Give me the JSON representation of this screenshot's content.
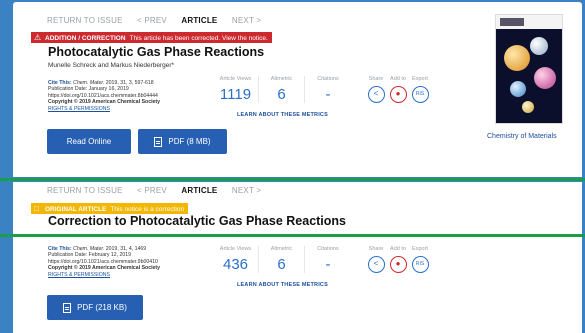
{
  "nav": {
    "return_to_issue": "RETURN TO ISSUE",
    "prev": "< PREV",
    "article": "ARTICLE",
    "next": "NEXT >"
  },
  "top": {
    "badge_strong": "ADDITION / CORRECTION",
    "badge_msg": "This article has been corrected. View the notice.",
    "title": "Photocatalytic Gas Phase Reactions",
    "authors": "Munelle Schreck and Markus Niederberger*",
    "cite_label": "Cite This:",
    "cite_journal": "Chem. Mater.",
    "cite_ref": "2019, 31, 3, 597-618",
    "pub_date": "Publication Date: January 16, 2019",
    "doi": "https://doi.org/10.1021/acs.chemmater.8b04444",
    "copyright": "Copyright © 2019 American Chemical Society",
    "rights": "RIGHTS & PERMISSIONS",
    "metrics": [
      {
        "label": "Article Views",
        "value": "1119"
      },
      {
        "label": "Altmetric",
        "value": "6"
      },
      {
        "label": "Citations",
        "value": "-"
      }
    ],
    "learn": "LEARN ABOUT THESE METRICS",
    "share": [
      {
        "label": "Share",
        "icon": "share-icon"
      },
      {
        "label": "Add to",
        "icon": "add-to-icon"
      },
      {
        "label": "Export",
        "icon": "export-icon",
        "text": "RIS"
      }
    ],
    "read_online": "Read Online",
    "pdf": "PDF (8 MB)",
    "journal_name": "Chemistry of Materials"
  },
  "bottom": {
    "badge_strong": "ORIGINAL ARTICLE",
    "badge_msg": "This notice is a correction",
    "title": "Correction to Photocatalytic Gas Phase Reactions",
    "cite_label": "Cite This:",
    "cite_journal": "Chem. Mater.",
    "cite_ref": "2019, 31, 4, 1469",
    "pub_date": "Publication Date: February 12, 2019",
    "doi": "https://doi.org/10.1021/acs.chemmater.9b00410",
    "copyright": "Copyright © 2019 American Chemical Society",
    "rights": "RIGHTS & PERMISSIONS",
    "metrics": [
      {
        "label": "Article Views",
        "value": "436"
      },
      {
        "label": "Altmetric",
        "value": "6"
      },
      {
        "label": "Citations",
        "value": "-"
      }
    ],
    "learn": "LEARN ABOUT THESE METRICS",
    "share": [
      {
        "label": "Share",
        "icon": "share-icon"
      },
      {
        "label": "Add to",
        "icon": "add-to-icon"
      },
      {
        "label": "Export",
        "icon": "export-icon",
        "text": "RIS"
      }
    ],
    "pdf": "PDF (218 KB)"
  },
  "colors": {
    "background": "#3b82c4",
    "highlight_line": "#18a049",
    "addition_badge": "#cc2a2f",
    "original_badge": "#f2b705",
    "button": "#2760b3",
    "metric_value": "#2a6fc9"
  }
}
